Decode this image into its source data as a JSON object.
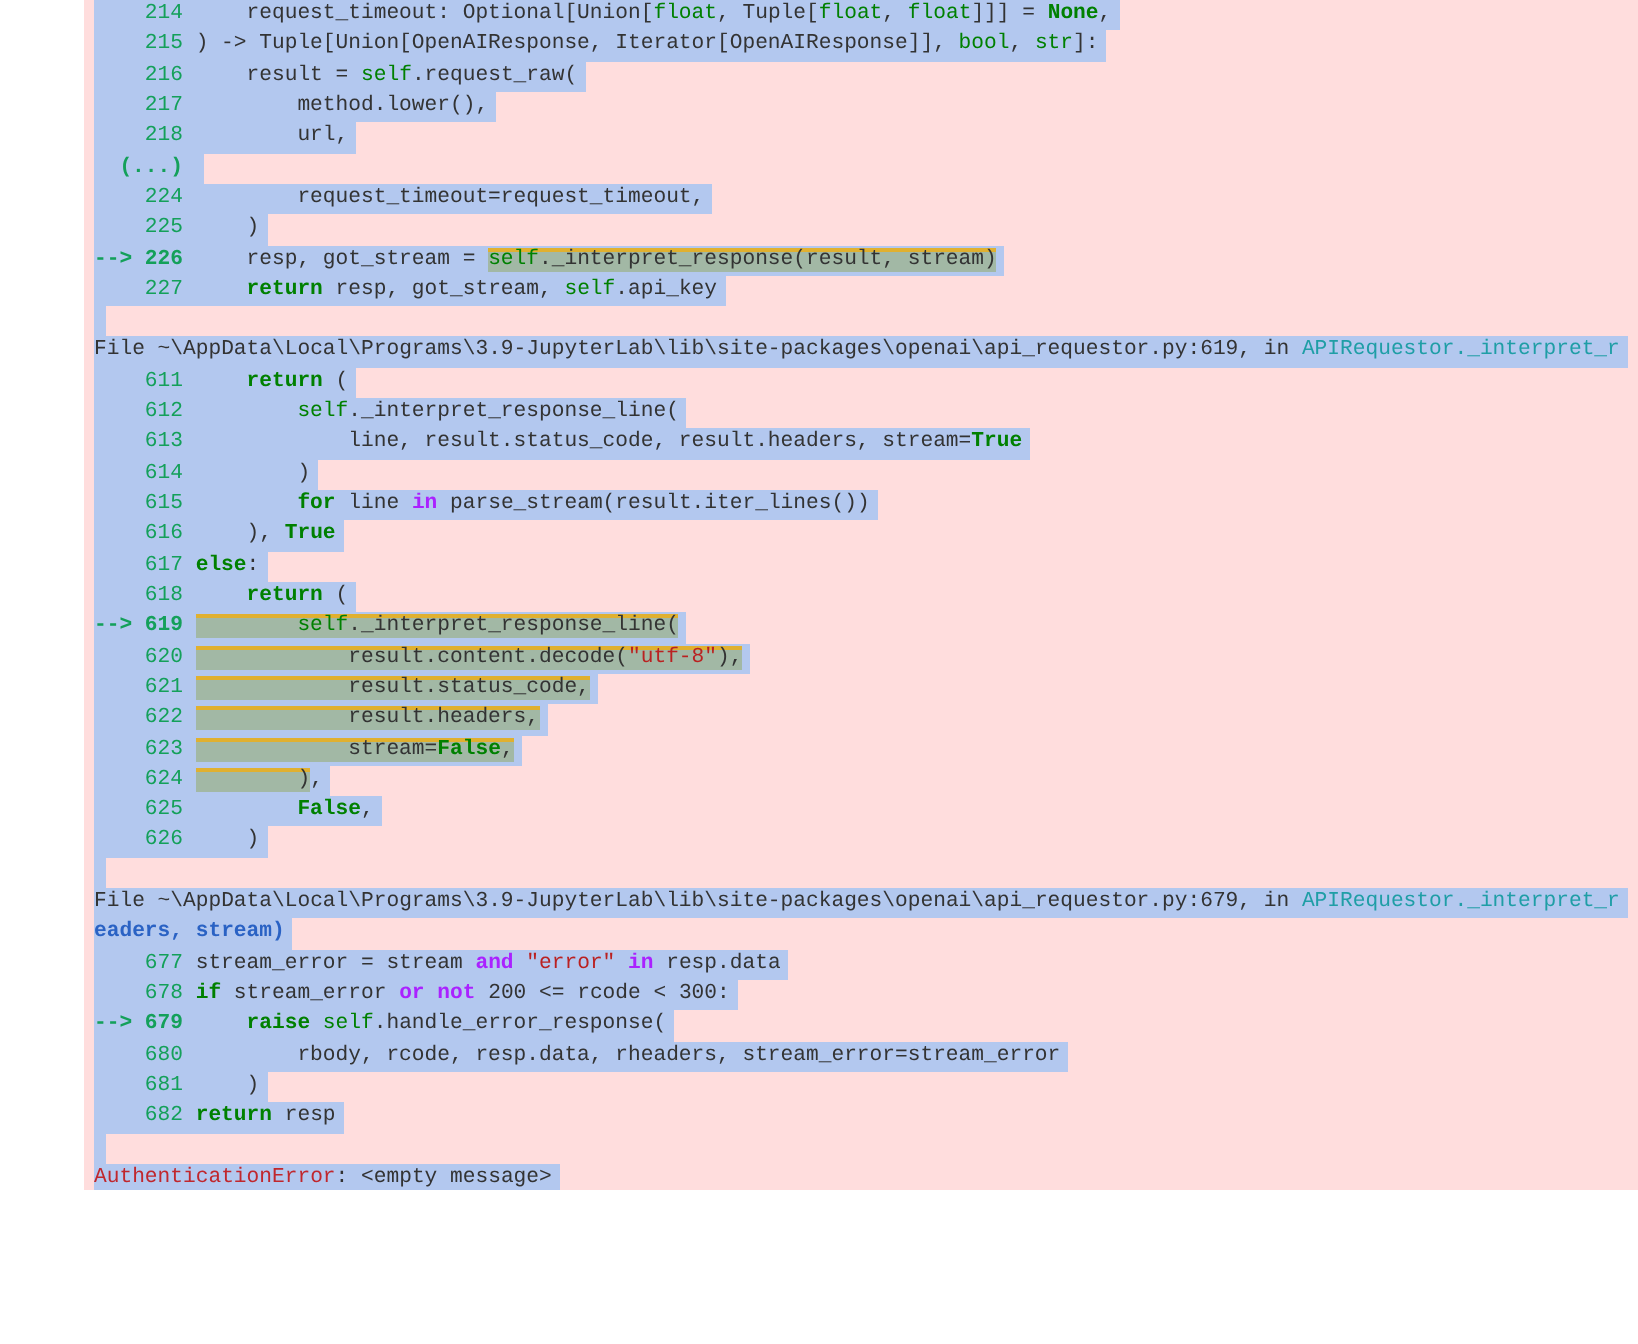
{
  "traceback": [
    {
      "kind": "code",
      "selected": true,
      "gutter": "214",
      "segments": [
        {
          "t": "    request_timeout: Optional[Union[",
          "kind": "plain"
        },
        {
          "t": "float",
          "kind": "builtin"
        },
        {
          "t": ", Tuple[",
          "kind": "plain"
        },
        {
          "t": "float",
          "kind": "builtin"
        },
        {
          "t": ", ",
          "kind": "plain"
        },
        {
          "t": "float",
          "kind": "builtin"
        },
        {
          "t": "]]] = ",
          "kind": "plain"
        },
        {
          "t": "None",
          "kind": "kw"
        },
        {
          "t": ",",
          "kind": "plain"
        }
      ]
    },
    {
      "kind": "code",
      "selected": true,
      "gutter": "215",
      "segments": [
        {
          "t": ") -> Tuple[Union[OpenAIResponse, Iterator[OpenAIResponse]], ",
          "kind": "plain"
        },
        {
          "t": "bool",
          "kind": "builtin"
        },
        {
          "t": ", ",
          "kind": "plain"
        },
        {
          "t": "str",
          "kind": "builtin"
        },
        {
          "t": "]:",
          "kind": "plain"
        }
      ]
    },
    {
      "kind": "code",
      "selected": true,
      "gutter": "216",
      "segments": [
        {
          "t": "    result = ",
          "kind": "plain"
        },
        {
          "t": "self",
          "kind": "builtin"
        },
        {
          "t": ".request_raw(",
          "kind": "plain"
        }
      ]
    },
    {
      "kind": "code",
      "selected": true,
      "gutter": "217",
      "segments": [
        {
          "t": "        method.lower(),",
          "kind": "plain"
        }
      ]
    },
    {
      "kind": "code",
      "selected": true,
      "gutter": "218",
      "segments": [
        {
          "t": "        url,",
          "kind": "plain"
        }
      ]
    },
    {
      "kind": "gap",
      "selected": true,
      "gutter": "(...)"
    },
    {
      "kind": "code",
      "selected": true,
      "gutter": "224",
      "segments": [
        {
          "t": "        request_timeout=request_timeout,",
          "kind": "plain"
        }
      ]
    },
    {
      "kind": "code",
      "selected": true,
      "gutter": "225",
      "segments": [
        {
          "t": "    )",
          "kind": "plain"
        }
      ]
    },
    {
      "kind": "code",
      "selected": true,
      "arrow": "-->",
      "gutter": "226",
      "segments": [
        {
          "t": "    resp, got_stream = ",
          "kind": "plain"
        },
        {
          "t": "self",
          "kind": "builtin",
          "focus": true
        },
        {
          "t": "._interpret_response(result, stream)",
          "kind": "plain",
          "focus": true
        }
      ]
    },
    {
      "kind": "code",
      "selected": true,
      "gutter": "227",
      "segments": [
        {
          "t": "    return",
          "kind": "kw"
        },
        {
          "t": " resp, got_stream, ",
          "kind": "plain"
        },
        {
          "t": "self",
          "kind": "builtin"
        },
        {
          "t": ".api_key",
          "kind": "plain"
        }
      ]
    },
    {
      "kind": "blank",
      "selected": true
    },
    {
      "kind": "file",
      "selected": true,
      "segments": [
        {
          "t": "File ~\\AppData\\Local\\Programs\\3.9-JupyterLab\\lib\\site-packages\\openai\\api_requestor.py:619, in ",
          "kind": "plain"
        },
        {
          "t": "APIRequestor._interpret_r",
          "kind": "func"
        }
      ]
    },
    {
      "kind": "code",
      "selected": true,
      "gutter": "611",
      "segments": [
        {
          "t": "    return",
          "kind": "kw"
        },
        {
          "t": " (",
          "kind": "plain"
        }
      ]
    },
    {
      "kind": "code",
      "selected": true,
      "gutter": "612",
      "segments": [
        {
          "t": "        self",
          "kind": "builtin"
        },
        {
          "t": "._interpret_response_line(",
          "kind": "plain"
        }
      ]
    },
    {
      "kind": "code",
      "selected": true,
      "gutter": "613",
      "segments": [
        {
          "t": "            line, result.status_code, result.headers, stream=",
          "kind": "plain"
        },
        {
          "t": "True",
          "kind": "kw"
        }
      ]
    },
    {
      "kind": "code",
      "selected": true,
      "gutter": "614",
      "segments": [
        {
          "t": "        )",
          "kind": "plain"
        }
      ]
    },
    {
      "kind": "code",
      "selected": true,
      "gutter": "615",
      "segments": [
        {
          "t": "        for",
          "kind": "kw"
        },
        {
          "t": " line ",
          "kind": "plain"
        },
        {
          "t": "in",
          "kind": "op"
        },
        {
          "t": " parse_stream(result.iter_lines())",
          "kind": "plain"
        }
      ]
    },
    {
      "kind": "code",
      "selected": true,
      "gutter": "616",
      "segments": [
        {
          "t": "    ), ",
          "kind": "plain"
        },
        {
          "t": "True",
          "kind": "kw"
        }
      ]
    },
    {
      "kind": "code",
      "selected": true,
      "gutter": "617",
      "segments": [
        {
          "t": "else",
          "kind": "kw"
        },
        {
          "t": ":",
          "kind": "plain"
        }
      ]
    },
    {
      "kind": "code",
      "selected": true,
      "gutter": "618",
      "segments": [
        {
          "t": "    return",
          "kind": "kw"
        },
        {
          "t": " (",
          "kind": "plain"
        }
      ]
    },
    {
      "kind": "code",
      "selected": true,
      "arrow": "-->",
      "gutter": "619",
      "segments": [
        {
          "t": "        self",
          "kind": "builtin",
          "focus": true
        },
        {
          "t": "._interpret_response_line(",
          "kind": "plain",
          "focus": true
        }
      ]
    },
    {
      "kind": "code",
      "selected": true,
      "gutter": "620",
      "segments": [
        {
          "t": "            result.content.decode(",
          "kind": "plain",
          "focus": true
        },
        {
          "t": "\"utf-8\"",
          "kind": "str",
          "focus": true
        },
        {
          "t": "),",
          "kind": "plain",
          "focus": true
        }
      ]
    },
    {
      "kind": "code",
      "selected": true,
      "gutter": "621",
      "segments": [
        {
          "t": "            result.status_code,",
          "kind": "plain",
          "focus": true
        }
      ]
    },
    {
      "kind": "code",
      "selected": true,
      "gutter": "622",
      "segments": [
        {
          "t": "            result.headers,",
          "kind": "plain",
          "focus": true
        }
      ]
    },
    {
      "kind": "code",
      "selected": true,
      "gutter": "623",
      "segments": [
        {
          "t": "            stream=",
          "kind": "plain",
          "focus": true
        },
        {
          "t": "False",
          "kind": "kw",
          "focus": true
        },
        {
          "t": ",",
          "kind": "plain",
          "focus": true
        }
      ]
    },
    {
      "kind": "code",
      "selected": true,
      "gutter": "624",
      "segments": [
        {
          "t": "        )",
          "kind": "plain",
          "focus": true
        },
        {
          "t": ",",
          "kind": "plain"
        }
      ]
    },
    {
      "kind": "code",
      "selected": true,
      "gutter": "625",
      "segments": [
        {
          "t": "        False",
          "kind": "kw"
        },
        {
          "t": ",",
          "kind": "plain"
        }
      ]
    },
    {
      "kind": "code",
      "selected": true,
      "gutter": "626",
      "segments": [
        {
          "t": "    )",
          "kind": "plain"
        }
      ]
    },
    {
      "kind": "blank",
      "selected": true
    },
    {
      "kind": "file",
      "selected": true,
      "segments": [
        {
          "t": "File ~\\AppData\\Local\\Programs\\3.9-JupyterLab\\lib\\site-packages\\openai\\api_requestor.py:679, in ",
          "kind": "plain"
        },
        {
          "t": "APIRequestor._interpret_r",
          "kind": "func"
        }
      ]
    },
    {
      "kind": "text",
      "selected": true,
      "segments": [
        {
          "t": "eaders, stream)",
          "kind": "sig"
        }
      ]
    },
    {
      "kind": "code",
      "selected": true,
      "gutter": "677",
      "segments": [
        {
          "t": "stream_error = stream ",
          "kind": "plain"
        },
        {
          "t": "and",
          "kind": "op"
        },
        {
          "t": " \"error\" ",
          "kind": "str"
        },
        {
          "t": "in",
          "kind": "op"
        },
        {
          "t": " resp.data",
          "kind": "plain"
        }
      ]
    },
    {
      "kind": "code",
      "selected": true,
      "gutter": "678",
      "segments": [
        {
          "t": "if",
          "kind": "kw"
        },
        {
          "t": " stream_error ",
          "kind": "plain"
        },
        {
          "t": "or",
          "kind": "op"
        },
        {
          "t": " not",
          "kind": "op"
        },
        {
          "t": " 200 <= rcode < 300:",
          "kind": "plain"
        }
      ]
    },
    {
      "kind": "code",
      "selected": true,
      "arrow": "-->",
      "gutter": "679",
      "segments": [
        {
          "t": "    raise",
          "kind": "kw"
        },
        {
          "t": " self",
          "kind": "builtin"
        },
        {
          "t": ".handle_error_response(",
          "kind": "plain"
        }
      ]
    },
    {
      "kind": "code",
      "selected": true,
      "gutter": "680",
      "segments": [
        {
          "t": "        rbody, rcode, resp.data, rheaders, stream_error=stream_error",
          "kind": "plain"
        }
      ]
    },
    {
      "kind": "code",
      "selected": true,
      "gutter": "681",
      "segments": [
        {
          "t": "    )",
          "kind": "plain"
        }
      ]
    },
    {
      "kind": "code",
      "selected": true,
      "gutter": "682",
      "segments": [
        {
          "t": "return",
          "kind": "kw"
        },
        {
          "t": " resp",
          "kind": "plain"
        }
      ]
    },
    {
      "kind": "blank",
      "selected": true
    },
    {
      "kind": "text",
      "selected": true,
      "segments": [
        {
          "t": "AuthenticationError",
          "kind": "error"
        },
        {
          "t": ": <empty message>",
          "kind": "plain"
        }
      ]
    }
  ]
}
